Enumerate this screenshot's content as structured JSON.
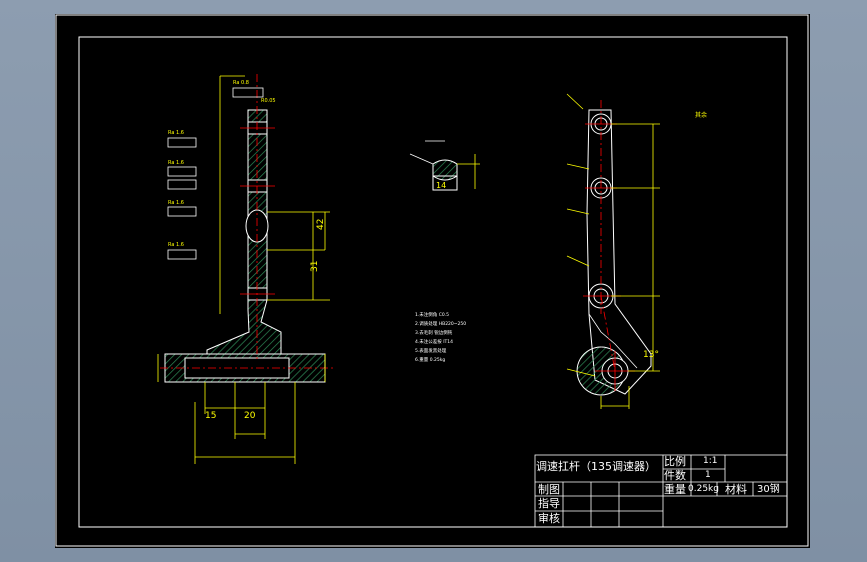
{
  "title_block": {
    "part_name": "调速扛杆（135调速器）",
    "scale_label": "比例",
    "scale_value": "1:1",
    "qty_label": "件数",
    "qty_value": "1",
    "weight_label": "重量",
    "weight_value": "0.25kg",
    "material_label": "材料",
    "material_value": "30钢",
    "drawn_label": "制图",
    "guide_label": "指导",
    "review_label": "审核"
  },
  "dims": {
    "d15": "15",
    "d20": "20",
    "d31": "31",
    "d42": "42",
    "d14": "14",
    "d13": "13°"
  },
  "colors": {
    "background": "#8d9db0",
    "sheet": "#000000",
    "frame": "#ffffff",
    "geometry": "#ffffff",
    "dimension": "#ffff00",
    "centerline": "#ff0000",
    "hatch": "#2e8b57",
    "tolerance_text": "#00ffff"
  }
}
